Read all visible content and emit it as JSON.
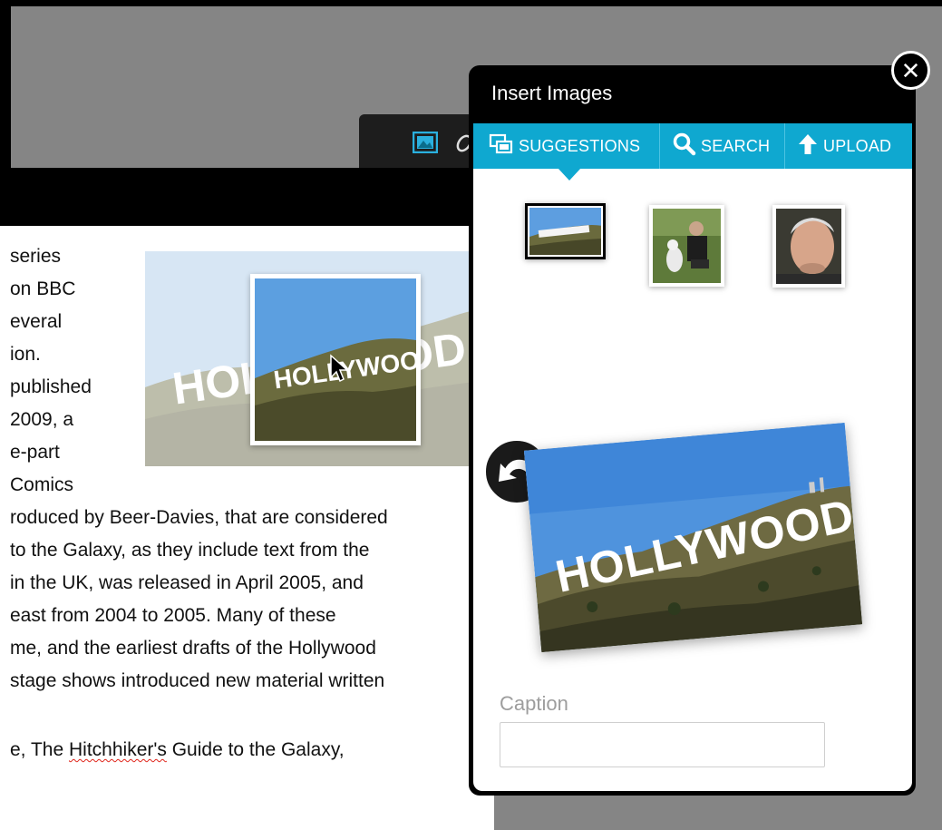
{
  "dialog": {
    "title": "Insert Images",
    "close_label": "✕",
    "tabs": [
      {
        "label": "SUGGESTIONS",
        "icon": "suggestions-icon"
      },
      {
        "label": "SEARCH",
        "icon": "search-icon"
      },
      {
        "label": "UPLOAD",
        "icon": "upload-icon"
      }
    ],
    "thumbnails": [
      {
        "name": "hollywood-sign",
        "selected": true
      },
      {
        "name": "man-with-dog",
        "selected": false
      },
      {
        "name": "man-portrait",
        "selected": false
      }
    ],
    "caption": {
      "label": "Caption",
      "value": "",
      "placeholder": ""
    },
    "preview_sign_text": "HOLLYWOOD"
  },
  "editor": {
    "toolbar_icons": [
      "image-icon",
      "link-icon"
    ],
    "lines": [
      "series",
      "on BBC",
      "everal",
      "ion.",
      "published",
      "2009, a",
      "e-part",
      "Comics",
      "roduced by Beer-Davies, that are considered",
      "to the Galaxy, as they include text from the",
      "in the UK, was released in April 2005, and",
      "east from 2004 to 2005. Many of these",
      "me, and the earliest drafts of the Hollywood",
      "stage shows introduced new material written"
    ],
    "last_line": {
      "before": "e, The ",
      "misspelled": "Hitchhiker's",
      "after": " Guide to the Galaxy,"
    },
    "inline_sign_text": "HOLLYWOOD",
    "drag_sign_text": "HOLLYWOOD"
  },
  "colors": {
    "accent": "#0fa8d0",
    "backdrop": "#858585",
    "dialog_frame": "#000000"
  }
}
